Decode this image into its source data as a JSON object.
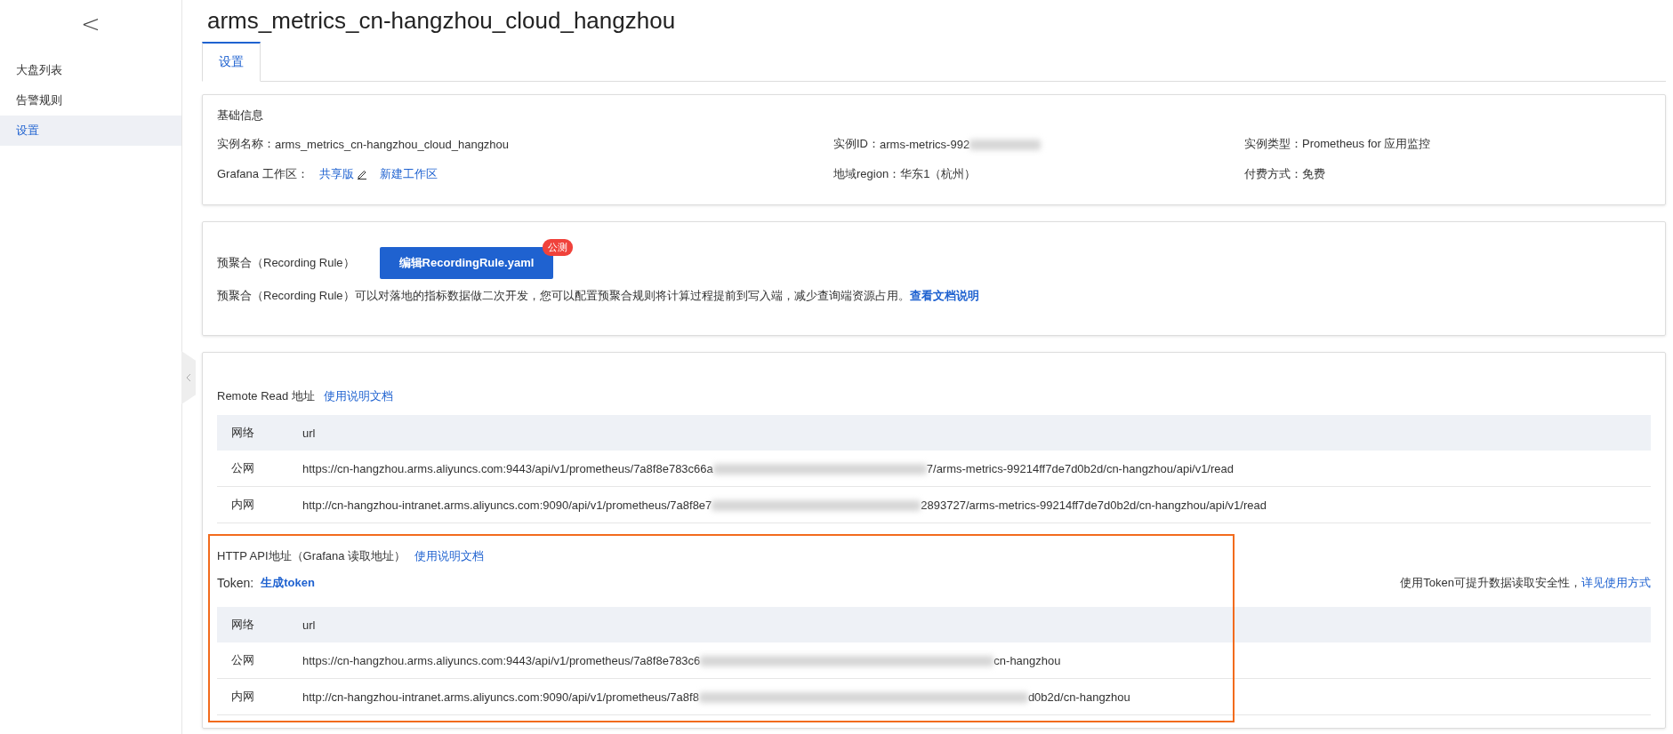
{
  "sidebar": {
    "back_label": "<",
    "items": [
      {
        "label": "大盘列表",
        "selected": false
      },
      {
        "label": "告警规则",
        "selected": false
      },
      {
        "label": "设置",
        "selected": true
      }
    ]
  },
  "page_title": "arms_metrics_cn-hangzhou_cloud_hangzhou",
  "tabs": [
    {
      "label": "设置",
      "selected": true
    }
  ],
  "basic_info": {
    "title": "基础信息",
    "fields": [
      {
        "label": "实例名称：",
        "value": "arms_metrics_cn-hangzhou_cloud_hangzhou",
        "redacted_tail": false
      },
      {
        "label": "实例ID：",
        "value": "arms-metrics-992",
        "redacted_tail": true
      },
      {
        "label": "实例类型：",
        "value": "Prometheus for 应用监控",
        "redacted_tail": false
      },
      {
        "label": "Grafana 工作区：",
        "links": [
          "共享版",
          "新建工作区"
        ]
      },
      {
        "label": "地域region：",
        "value": "华东1（杭州）",
        "redacted_tail": false
      },
      {
        "label": "付费方式：",
        "value": "免费",
        "redacted_tail": false
      }
    ]
  },
  "recording_rule": {
    "label": "预聚合（Recording Rule）",
    "button": "编辑RecordingRule.yaml",
    "badge": "公测",
    "description": "预聚合（Recording Rule）可以对落地的指标数据做二次开发，您可以配置预聚合规则将计算过程提前到写入端，减少查询端资源占用。",
    "doc_link": "查看文档说明"
  },
  "remote_read": {
    "title": "Remote Read 地址",
    "doc_link": "使用说明文档",
    "columns": [
      "网络",
      "url"
    ],
    "rows": [
      {
        "network": "公网",
        "url_start": "https://cn-hangzhou.arms.aliyuncs.com:9443/api/v1/prometheus/7a8f8e783c66a",
        "url_end": "7/arms-metrics-99214ff7de7d0b2d/cn-hangzhou/api/v1/read"
      },
      {
        "network": "内网",
        "url_start": "http://cn-hangzhou-intranet.arms.aliyuncs.com:9090/api/v1/prometheus/7a8f8e7",
        "url_end": "2893727/arms-metrics-99214ff7de7d0b2d/cn-hangzhou/api/v1/read"
      }
    ]
  },
  "http_api": {
    "title": "HTTP API地址（Grafana 读取地址）",
    "doc_link": "使用说明文档",
    "token_label": "Token:",
    "token_link": "生成token",
    "token_hint": "使用Token可提升数据读取安全性，",
    "token_hint_link": "详见使用方式",
    "highlighted": true,
    "columns": [
      "网络",
      "url"
    ],
    "rows": [
      {
        "network": "公网",
        "url_start": "https://cn-hangzhou.arms.aliyuncs.com:9443/api/v1/prometheus/7a8f8e783c6",
        "url_end": "cn-hangzhou"
      },
      {
        "network": "内网",
        "url_start": "http://cn-hangzhou-intranet.arms.aliyuncs.com:9090/api/v1/prometheus/7a8f8",
        "url_end": "d0b2d/cn-hangzhou"
      }
    ]
  }
}
